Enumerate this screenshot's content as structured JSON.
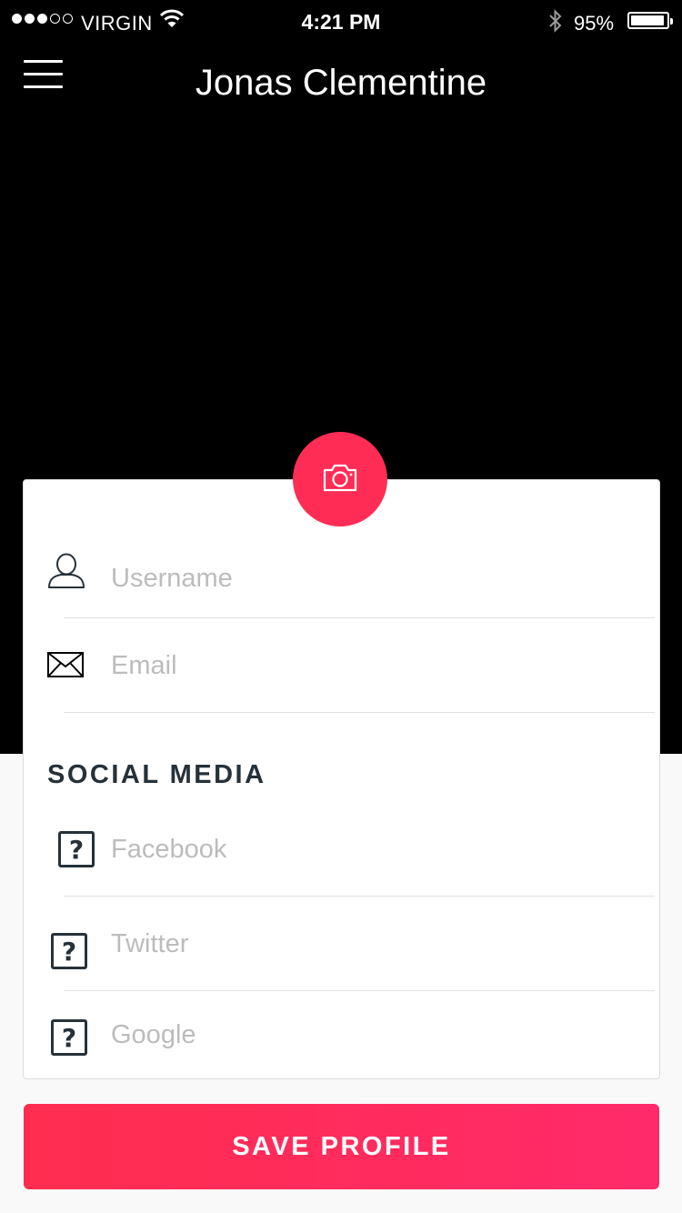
{
  "status_bar": {
    "carrier": "VIRGIN",
    "time": "4:21 PM",
    "battery_text": "95%",
    "signal_bars_filled": 3,
    "signal_bars_total": 5
  },
  "header": {
    "title": "Jonas Clementine",
    "menu_icon": "hamburger-menu-icon"
  },
  "profile": {
    "camera_icon": "camera-icon",
    "username_placeholder": "Username",
    "email_placeholder": "Email"
  },
  "social": {
    "heading": "SOCIAL MEDIA",
    "facebook_placeholder": "Facebook",
    "twitter_placeholder": "Twitter",
    "google_placeholder": "Google",
    "icon_glyph": "?"
  },
  "actions": {
    "save_label": "SAVE PROFILE"
  },
  "colors": {
    "accent": "#ff2d55",
    "dark_text": "#26313a",
    "placeholder": "#bcbcbc"
  }
}
